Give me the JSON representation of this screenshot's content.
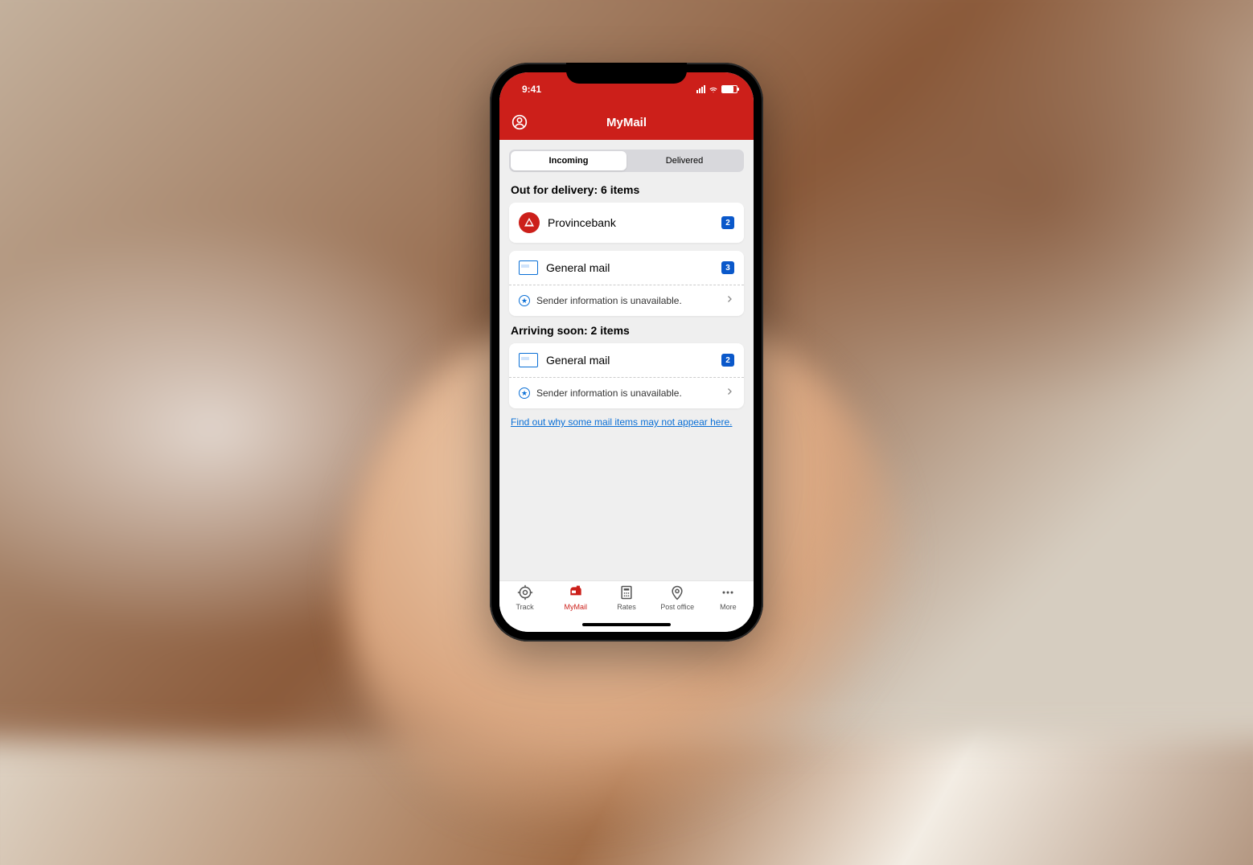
{
  "status": {
    "time": "9:41"
  },
  "header": {
    "title": "MyMail"
  },
  "segmented": {
    "incoming": "Incoming",
    "delivered": "Delivered"
  },
  "sections": {
    "out_for_delivery": {
      "title": "Out for delivery: 6 items",
      "items": [
        {
          "name": "Provincebank",
          "badge": "2",
          "icon": "bank"
        },
        {
          "name": "General mail",
          "badge": "3",
          "icon": "mail",
          "sub": "Sender information is unavailable."
        }
      ]
    },
    "arriving_soon": {
      "title": "Arriving soon: 2 items",
      "items": [
        {
          "name": "General mail",
          "badge": "2",
          "icon": "mail",
          "sub": "Sender information is unavailable."
        }
      ]
    }
  },
  "link": "Find out why some mail items may not appear here.",
  "tabs": {
    "track": "Track",
    "mymail": "MyMail",
    "rates": "Rates",
    "postoffice": "Post office",
    "more": "More"
  }
}
